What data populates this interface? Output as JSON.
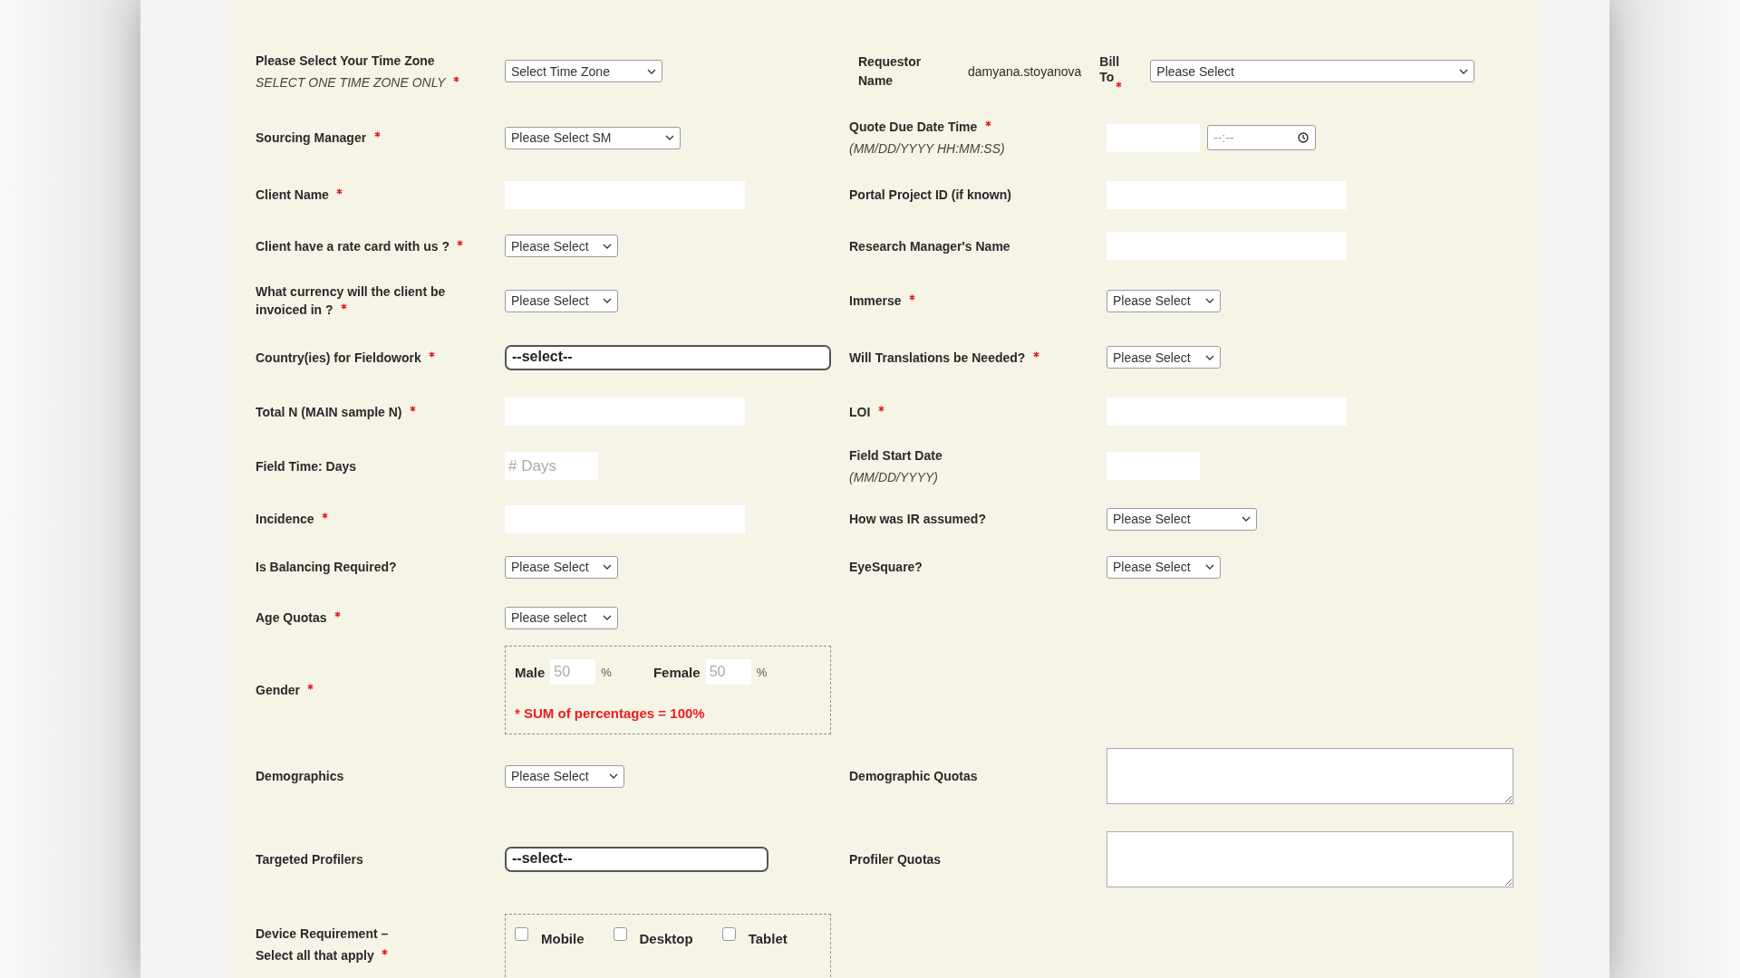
{
  "rows": [
    {
      "left": {
        "label": [
          {
            "text": "Please Select Your Time Zone",
            "hint": false,
            "required": false
          },
          {
            "text": "SELECT ONE TIME ZONE ONLY",
            "hint": true,
            "required": true
          }
        ],
        "control": {
          "kind": "select",
          "value": "Select Time Zone"
        }
      },
      "right": {
        "kind": "requestor",
        "label": "Requestor Name",
        "value": "damyana.stoyanova",
        "bill_label": "Bill To",
        "bill_required": true,
        "bill_value": "Please Select"
      }
    },
    {
      "left": {
        "label": [
          {
            "text": "Sourcing Manager",
            "hint": false,
            "required": true
          }
        ],
        "control": {
          "kind": "select",
          "value": "Please Select SM"
        }
      },
      "right": {
        "kind": "field",
        "label": [
          {
            "text": "Quote Due Date Time",
            "hint": false,
            "required": true
          },
          {
            "text": "(MM/DD/YYYY HH:MM:SS)",
            "hint": true,
            "required": false
          }
        ],
        "control": {
          "kind": "datetime",
          "time_placeholder": "--:--"
        }
      }
    },
    {
      "left": {
        "label": [
          {
            "text": "Client Name",
            "hint": false,
            "required": true
          }
        ],
        "control": {
          "kind": "text"
        }
      },
      "right": {
        "kind": "field",
        "label": [
          {
            "text": "Portal Project ID (if known)",
            "hint": false,
            "required": false
          }
        ],
        "control": {
          "kind": "text"
        }
      }
    },
    {
      "left": {
        "label": [
          {
            "text": "Client have a rate card with us ?",
            "hint": false,
            "required": true
          }
        ],
        "control": {
          "kind": "select",
          "value": "Please Select"
        }
      },
      "right": {
        "kind": "field",
        "label": [
          {
            "text": "Research Manager's Name",
            "hint": false,
            "required": false
          }
        ],
        "control": {
          "kind": "text"
        }
      }
    },
    {
      "left": {
        "label": [
          {
            "text": "What currency will the client be invoiced in ?",
            "hint": false,
            "required": true
          }
        ],
        "control": {
          "kind": "select",
          "value": "Please Select"
        }
      },
      "right": {
        "kind": "field",
        "label": [
          {
            "text": "Immerse",
            "hint": false,
            "required": true
          }
        ],
        "control": {
          "kind": "select",
          "value": "Please Select"
        }
      }
    },
    {
      "left": {
        "label": [
          {
            "text": "Country(ies) for Fieldowork",
            "hint": false,
            "required": true
          }
        ],
        "control": {
          "kind": "multiselect",
          "value": "--select--"
        }
      },
      "right": {
        "kind": "field",
        "label": [
          {
            "text": "Will Translations be Needed?",
            "hint": false,
            "required": true
          }
        ],
        "control": {
          "kind": "select",
          "value": "Please Select"
        }
      }
    },
    {
      "left": {
        "label": [
          {
            "text": "Total N (MAIN sample N)",
            "hint": false,
            "required": true
          }
        ],
        "control": {
          "kind": "text"
        }
      },
      "right": {
        "kind": "field",
        "label": [
          {
            "text": "LOI",
            "hint": false,
            "required": true
          }
        ],
        "control": {
          "kind": "text"
        }
      }
    },
    {
      "left": {
        "label": [
          {
            "text": "Field Time: Days",
            "hint": false,
            "required": false
          }
        ],
        "control": {
          "kind": "text",
          "placeholder": "# Days"
        }
      },
      "right": {
        "kind": "field",
        "label": [
          {
            "text": "Field Start Date",
            "hint": false,
            "required": false
          },
          {
            "text": "(MM/DD/YYYY)",
            "hint": true,
            "required": false
          }
        ],
        "control": {
          "kind": "text"
        }
      }
    },
    {
      "left": {
        "label": [
          {
            "text": "Incidence",
            "hint": false,
            "required": true
          }
        ],
        "control": {
          "kind": "text"
        }
      },
      "right": {
        "kind": "field",
        "label": [
          {
            "text": "How was IR assumed?",
            "hint": false,
            "required": false
          }
        ],
        "control": {
          "kind": "select",
          "value": "Please Select"
        }
      }
    },
    {
      "left": {
        "label": [
          {
            "text": "Is Balancing Required?",
            "hint": false,
            "required": false
          }
        ],
        "control": {
          "kind": "select",
          "value": "Please Select"
        }
      },
      "right": {
        "kind": "field",
        "label": [
          {
            "text": "EyeSquare?",
            "hint": false,
            "required": false
          }
        ],
        "control": {
          "kind": "select",
          "value": "Please Select"
        }
      }
    },
    {
      "left": {
        "label": [
          {
            "text": "Age Quotas",
            "hint": false,
            "required": true
          }
        ],
        "control": {
          "kind": "select",
          "value": "Please select"
        }
      }
    },
    {
      "left": {
        "label": [
          {
            "text": "Gender",
            "hint": false,
            "required": true
          }
        ],
        "control": {
          "kind": "gender",
          "items": [
            {
              "label": "Male",
              "placeholder": "50",
              "unit": "%"
            },
            {
              "label": "Female",
              "placeholder": "50",
              "unit": "%"
            }
          ],
          "note": "* SUM of percentages = 100%"
        }
      }
    },
    {
      "left": {
        "label": [
          {
            "text": "Demographics",
            "hint": false,
            "required": false
          }
        ],
        "control": {
          "kind": "select",
          "value": "Please Select"
        }
      },
      "right": {
        "kind": "field",
        "label": [
          {
            "text": "Demographic Quotas",
            "hint": false,
            "required": false
          }
        ],
        "control": {
          "kind": "textarea"
        }
      }
    },
    {
      "left": {
        "label": [
          {
            "text": "Targeted Profilers",
            "hint": false,
            "required": false
          }
        ],
        "control": {
          "kind": "multiselect",
          "value": "--select--"
        }
      },
      "right": {
        "kind": "field",
        "label": [
          {
            "text": "Profiler Quotas",
            "hint": false,
            "required": false
          }
        ],
        "control": {
          "kind": "textarea"
        }
      }
    },
    {
      "left": {
        "label": [
          {
            "text": "Device Requirement –",
            "hint": false,
            "required": false
          },
          {
            "text": "Select all that apply",
            "hint": false,
            "required": true
          }
        ],
        "control": {
          "kind": "checkboxes",
          "items": [
            {
              "label": "Mobile",
              "checked": false
            },
            {
              "label": "Desktop",
              "checked": false
            },
            {
              "label": "Tablet",
              "checked": false
            }
          ]
        }
      }
    }
  ]
}
